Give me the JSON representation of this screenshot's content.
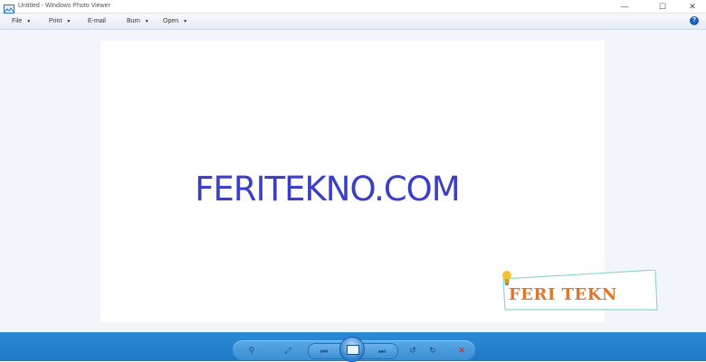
{
  "window": {
    "title": "Untitled - Windows Photo Viewer",
    "controls": {
      "minimize": "—",
      "maximize": "☐",
      "close": "✕"
    }
  },
  "menu": {
    "items": [
      {
        "label": "File",
        "has_dropdown": true
      },
      {
        "label": "Print",
        "has_dropdown": true
      },
      {
        "label": "E-mail",
        "has_dropdown": false
      },
      {
        "label": "Burn",
        "has_dropdown": true
      },
      {
        "label": "Open",
        "has_dropdown": true
      }
    ],
    "dropdown_glyph": "▼",
    "help_glyph": "?"
  },
  "image": {
    "main_text": "FERITEKNO.COM",
    "main_text_color": "#3b3fc8",
    "watermark_text": "FERI TEKN",
    "watermark_color": "#e0762c"
  },
  "toolbar": {
    "zoom_icon": "⚲",
    "actual_size_icon": "⤢",
    "previous_icon": "⏮",
    "next_icon": "⏭",
    "rotate_ccw_icon": "↺",
    "rotate_cw_icon": "↻",
    "delete_icon": "✕"
  },
  "colors": {
    "bottom_bar": "#1f78c6",
    "accent": "#2a8ad6",
    "background": "#f2f5fa"
  }
}
